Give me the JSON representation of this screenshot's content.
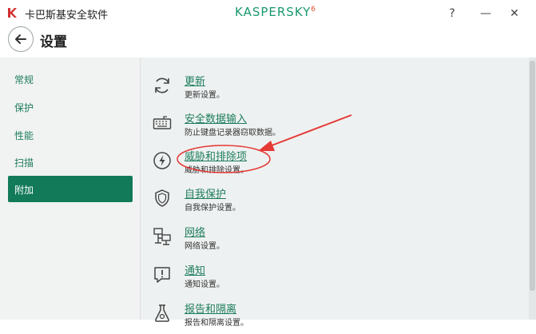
{
  "window": {
    "title": "卡巴斯基安全软件",
    "brand": "KASPERSKY",
    "brand_badge": "6",
    "help_glyph": "?",
    "min_glyph": "—",
    "close_glyph": "✕"
  },
  "header": {
    "title": "设置",
    "back_icon": "arrow-left-icon"
  },
  "sidebar": {
    "items": [
      {
        "label": "常规"
      },
      {
        "label": "保护"
      },
      {
        "label": "性能"
      },
      {
        "label": "扫描"
      },
      {
        "label": "附加",
        "active": true
      }
    ]
  },
  "settings": [
    {
      "title": "更新",
      "desc": "更新设置。",
      "icon": "refresh-icon"
    },
    {
      "title": "安全数据输入",
      "desc": "防止键盘记录器窃取数据。",
      "icon": "keyboard-icon"
    },
    {
      "title": "威胁和排除项",
      "desc": "威胁和排除设置。",
      "icon": "lightning-icon"
    },
    {
      "title": "自我保护",
      "desc": "自我保护设置。",
      "icon": "shield-icon"
    },
    {
      "title": "网络",
      "desc": "网络设置。",
      "icon": "network-icon"
    },
    {
      "title": "通知",
      "desc": "通知设置。",
      "icon": "notification-icon"
    },
    {
      "title": "报告和隔离",
      "desc": "报告和隔离设置。",
      "icon": "flask-icon"
    }
  ],
  "colors": {
    "accent": "#127a59",
    "link": "#1d7d5d",
    "annotation": "#e53935"
  }
}
